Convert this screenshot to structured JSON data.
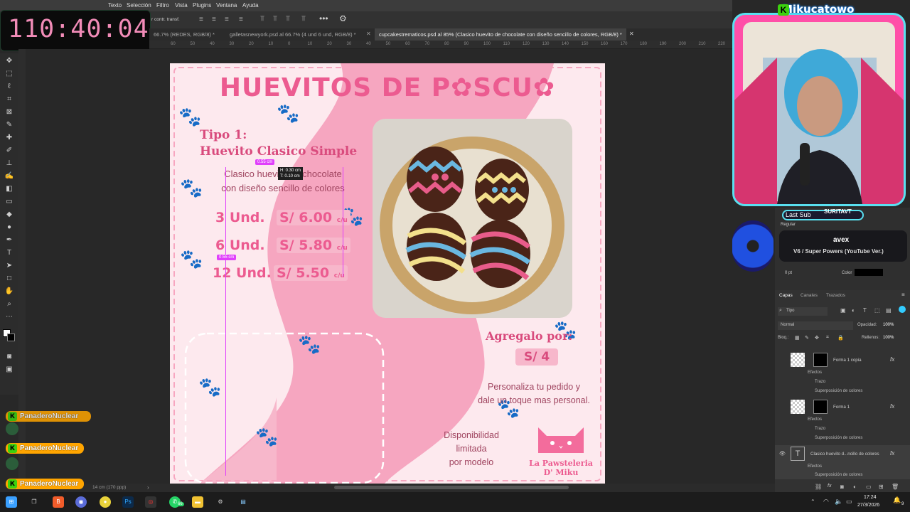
{
  "timer": "110:40:04",
  "menu": [
    "Texto",
    "Selección",
    "Filtro",
    "Vista",
    "Plugins",
    "Ventana",
    "Ayuda"
  ],
  "options": {
    "transform_label": "r contr. transf."
  },
  "tabs": [
    {
      "label": "66.7% (REDES, RGB/8) *"
    },
    {
      "label": "galletasnewyork.psd al 66.7% (4 und   6 und, RGB/8) *"
    },
    {
      "label": "cupcakestrematicos.psd al 85% (Clasico huevito de chocolate con diseño sencillo de colores, RGB/8) *"
    }
  ],
  "ruler": [
    "60",
    "50",
    "40",
    "30",
    "20",
    "10",
    "0",
    "10",
    "20",
    "30",
    "40",
    "50",
    "60",
    "70",
    "80",
    "90",
    "100",
    "110",
    "120",
    "130",
    "140",
    "150",
    "160",
    "170",
    "180",
    "190",
    "200",
    "210",
    "220"
  ],
  "artboard": {
    "title": "HUEVITOS DE P✿SCU✿",
    "type_line1": "Tipo 1:",
    "type_line2": "Huevito Clasico Simple",
    "desc_line1": "Clasico huevito de chocolate",
    "desc_line2": "con diseño sencillo de colores",
    "prices": [
      {
        "qty": "3 Und.",
        "price": "S/ 6.00",
        "unit": "c/u"
      },
      {
        "qty": "6 Und.",
        "price": "S/ 5.80",
        "unit": "c/u"
      },
      {
        "qty": "12 Und.",
        "price": "S/ 5.50",
        "unit": "c/u"
      }
    ],
    "add_label": "Agregalo por:",
    "add_price": "S/ 4",
    "personaliza_line1": "Personaliza tu pedido y",
    "personaliza_line2": "dale un toque mas personal.",
    "dispo_line1": "Disponibilidad limitada",
    "dispo_line2": "por modelo",
    "brand_line1": "La Pawsteleria",
    "brand_line2": "D' Miku",
    "measure_1": "0.55 cm",
    "measure_2": "0.55 cm",
    "measure_tooltip_1": "H: 0.30 cm",
    "measure_tooltip_2": "T: 0.10 cm"
  },
  "stream": {
    "channel": "Mikucatowo",
    "last_sub_label": "Last Sub",
    "last_sub_name": "SURITAVT",
    "song_artist": "avex",
    "song_title": "V6 / Super Powers (YouTube Ver.)"
  },
  "chat": [
    {
      "name": "PanaderoNuclear"
    },
    {
      "name": "PanaderoNuclear"
    }
  ],
  "chat_partial": "PanaderoNuclear",
  "panel": {
    "font_style": "Regular",
    "spacing": "0 pt",
    "color_label": "Color"
  },
  "layers_panel": {
    "tabs": [
      "Capas",
      "Canales",
      "Trazados"
    ],
    "filter": "Tipo",
    "blend_mode": "Normal",
    "opacity_label": "Opacidad:",
    "opacity_value": "100%",
    "lock_label": "Bloq.:",
    "fill_label": "Rellenos:",
    "fill_value": "100%",
    "layers": [
      {
        "name": "Forma 1 copia",
        "effects": "Efectos",
        "e1": "Trazo",
        "e2": "Superposición de colores"
      },
      {
        "name": "Forma 1",
        "effects": "Efectos",
        "e1": "Trazo",
        "e2": "Superposición de colores"
      },
      {
        "name": "Clasico huevito d...ncillo de colores",
        "effects": "Efectos",
        "e1": "Superposición de colores"
      }
    ]
  },
  "status": {
    "doc_size": "14 cm (170 ppp)"
  },
  "taskbar": {
    "time": "17:24",
    "date": "27/3/2026",
    "badge": "66",
    "notif": "9"
  },
  "colors": {
    "accent_pink": "#ec5b90",
    "artboard_bg": "#fde9ee",
    "webcam_border": "#59e0f0"
  }
}
